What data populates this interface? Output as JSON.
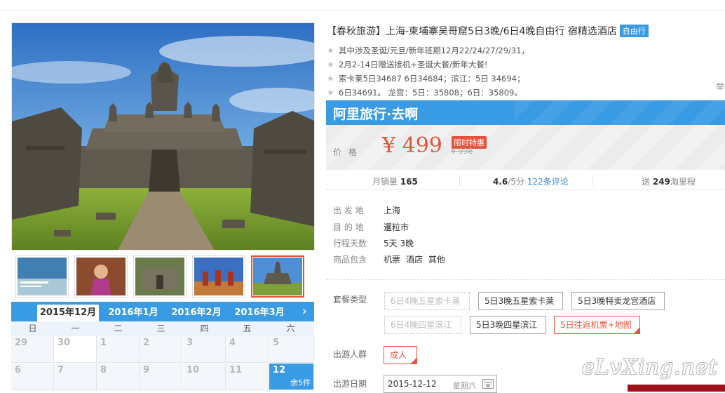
{
  "product": {
    "title": "【春秋旅游】上海-柬埔寨吴哥窟5日3晚/6日4晚自由行 宿精选酒店",
    "badge": "自由行",
    "notes": [
      "其中涉及圣诞/元旦/新年班期12月22/24/27/29/31，",
      "2月2-14日赠送接机+圣诞大餐/新年大餐!",
      "索卡莱5日34687 6日34684；滨江：5日 34694；",
      "6日34691。 龙宫：5日：35808；6日：35809。"
    ],
    "edge_char": "举"
  },
  "promo": {
    "bar_text": "阿里旅行·去啊",
    "price_label": "价格",
    "price": "¥ 499",
    "tag": "限时特惠",
    "old_price": "¥ 998"
  },
  "stats": {
    "sales_label": "月销量",
    "sales_value": "165",
    "rating": "4.6",
    "rating_suffix": "/5分",
    "reviews": "122条评论",
    "points_prefix": "送",
    "points_value": "249",
    "points_suffix": "淘里程"
  },
  "props": [
    {
      "key": "出 发 地",
      "value": "上海"
    },
    {
      "key": "目 的 地",
      "value": "暹粒市"
    },
    {
      "key": "行程天数",
      "value": "5天 3晚"
    },
    {
      "key": "商品包含",
      "items": [
        "机票",
        "酒店",
        "其他"
      ]
    }
  ],
  "options": {
    "package_label": "套餐类型",
    "packages": [
      {
        "label": "6日4晚五星索卡莱",
        "state": "disabled"
      },
      {
        "label": "5日3晚五星索卡莱",
        "state": "normal"
      },
      {
        "label": "5日3晚特卖龙宫酒店",
        "state": "normal"
      },
      {
        "label": "6日4晚四星滨江",
        "state": "disabled"
      },
      {
        "label": "5日3晚四星滨江",
        "state": "normal"
      },
      {
        "label": "5日往返机票+地图",
        "state": "selected"
      }
    ],
    "people_label": "出游人群",
    "people": [
      {
        "label": "成人",
        "state": "selected"
      }
    ],
    "date_label": "出游日期",
    "date_value": "2015-12-12",
    "date_weekday": "星期六"
  },
  "calendar": {
    "months": [
      "2015年12月",
      "2016年1月",
      "2016年2月",
      "2016年3月"
    ],
    "active_month": 0,
    "weekdays": [
      "日",
      "一",
      "二",
      "三",
      "四",
      "五",
      "六"
    ],
    "rows": [
      [
        "29",
        "30",
        "1",
        "2",
        "3",
        "4",
        "5"
      ],
      [
        "6",
        "7",
        "8",
        "9",
        "10",
        "11",
        "12"
      ]
    ],
    "selected_day": "12",
    "selected_stock": "余5件",
    "next_icon": "chevron-right-icon"
  },
  "gallery": {
    "thumb_count": 5,
    "active_thumb": 4
  },
  "watermark": "eLvXing.net",
  "colors": {
    "accent_blue": "#3a9be5",
    "price_red": "#e5533c"
  }
}
